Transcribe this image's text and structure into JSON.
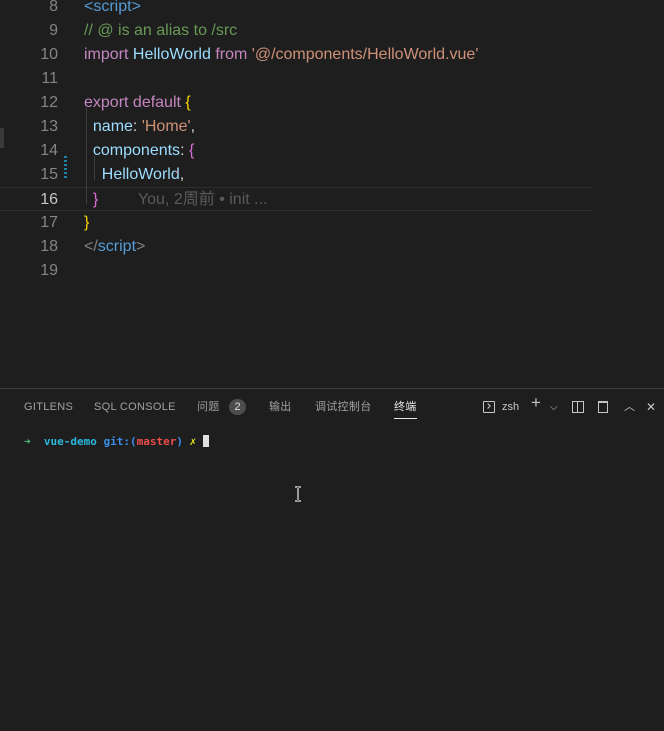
{
  "editor": {
    "lines": [
      {
        "num": "8",
        "tokens": [
          [
            "tag",
            "<script>"
          ]
        ]
      },
      {
        "num": "9",
        "tokens": [
          [
            "cmt",
            "// @ is an alias to /src"
          ]
        ]
      },
      {
        "num": "10",
        "tokens": [
          [
            "kw",
            "import "
          ],
          [
            "var",
            "HelloWorld "
          ],
          [
            "kw",
            "from "
          ],
          [
            "str",
            "'@/components/HelloWorld.vue'"
          ]
        ]
      },
      {
        "num": "11",
        "tokens": []
      },
      {
        "num": "12",
        "tokens": [
          [
            "kw",
            "export default "
          ],
          [
            "b1",
            "{"
          ]
        ]
      },
      {
        "num": "13",
        "tokens": [
          [
            "plain",
            "  "
          ],
          [
            "var",
            "name"
          ],
          [
            "plain",
            ": "
          ],
          [
            "str",
            "'Home'"
          ],
          [
            "plain",
            ","
          ]
        ]
      },
      {
        "num": "14",
        "tokens": [
          [
            "plain",
            "  "
          ],
          [
            "var",
            "components"
          ],
          [
            "plain",
            ": "
          ],
          [
            "b2",
            "{"
          ]
        ]
      },
      {
        "num": "15",
        "tokens": [
          [
            "plain",
            "    "
          ],
          [
            "var",
            "HelloWorld"
          ],
          [
            "plain",
            ","
          ]
        ]
      },
      {
        "num": "16",
        "tokens": [
          [
            "plain",
            "  "
          ],
          [
            "b2",
            "}"
          ],
          [
            "ghost",
            "         You, 2周前 • init ..."
          ]
        ]
      },
      {
        "num": "17",
        "tokens": [
          [
            "b1",
            "}"
          ]
        ]
      },
      {
        "num": "18",
        "tokens": [
          [
            "punc",
            "</"
          ],
          [
            "tag",
            "script"
          ],
          [
            "punc",
            ">"
          ]
        ]
      },
      {
        "num": "19",
        "tokens": []
      }
    ],
    "current_line": "16"
  },
  "panel": {
    "tabs": {
      "gitlens": "GITLENS",
      "sql_console": "SQL CONSOLE",
      "problems": "问题",
      "problems_count": "2",
      "output": "输出",
      "debug_console": "调试控制台",
      "terminal": "终端"
    },
    "terminal_shell": "zsh",
    "tools": {
      "add": "+",
      "dropdown": "⌵",
      "maximize": "︿",
      "close": "✕"
    },
    "terminal": {
      "arrow": "➜",
      "dir": "vue-demo",
      "git_label": "git:(",
      "branch": "master",
      "git_close": ")",
      "dirty": "✗"
    }
  }
}
